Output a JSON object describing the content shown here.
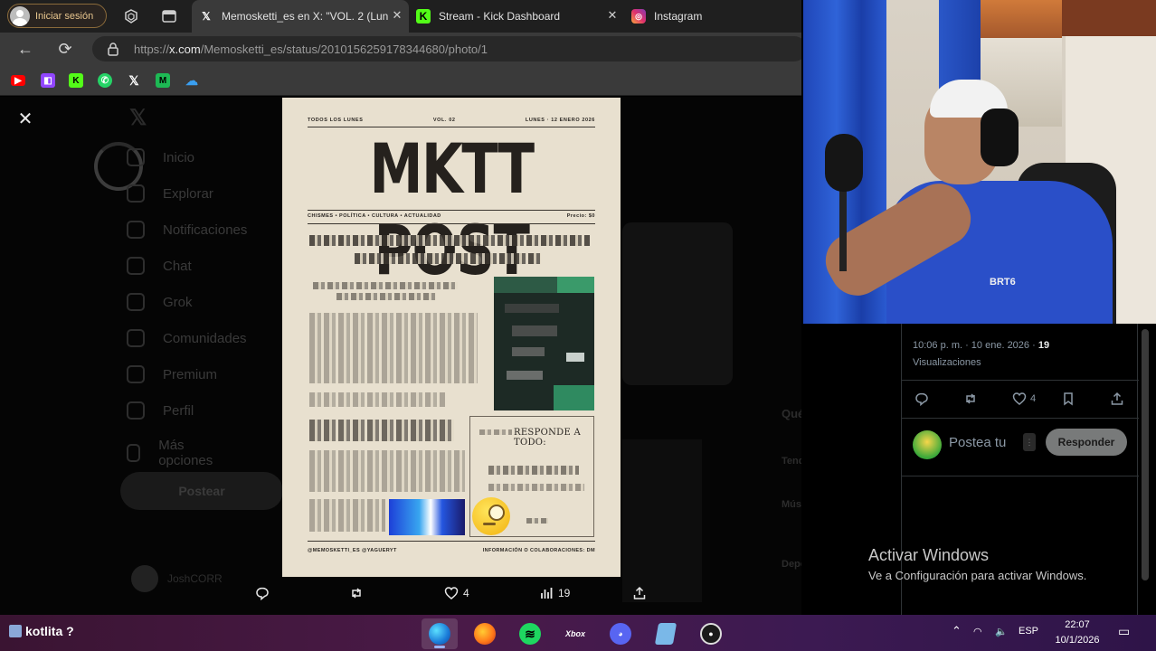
{
  "browser": {
    "profile_label": "Iniciar sesión",
    "tabs": [
      {
        "title": "Memosketti_es en X: \"VOL. 2 (Lun",
        "favicon": "X"
      },
      {
        "title": "Stream - Kick Dashboard",
        "favicon": "K"
      },
      {
        "title": "Instagram",
        "favicon": "instagram-icon"
      }
    ],
    "url_prefix": "https://",
    "url_host": "x.com",
    "url_path": "/Memosketti_es/status/2010156259178344680/photo/1",
    "bookmarks": [
      "youtube-icon",
      "twitch-icon",
      "kick-icon",
      "whatsapp-icon",
      "x-icon",
      "medium-icon",
      "cloud-icon"
    ]
  },
  "x_page": {
    "nav_items": [
      "Inicio",
      "Explorar",
      "Notificaciones",
      "Chat",
      "Grok",
      "Comunidades",
      "Premium",
      "Perfil",
      "Más opciones"
    ],
    "post_button": "Postear",
    "user_name": "JoshCORR",
    "side_heading": "Qué está pasando",
    "side_labels": [
      "Tendencias",
      "Música",
      "Deportes"
    ]
  },
  "newspaper": {
    "top_left": "TODOS LOS LUNES",
    "top_center": "VOL. 02",
    "top_right": "LUNES · 12 ENERO 2026",
    "masthead": "MKTT POST",
    "sections": "CHISMES • POLÍTICA • CULTURA • ACTUALIDAD",
    "price": "Precio: $0",
    "box_title": "RESPONDE A TODO:",
    "footer_left": "@MEMOSKETTI_ES   @YAGUERYT",
    "footer_right": "INFORMACIÓN O COLABORACIONES: DM"
  },
  "media_actions": {
    "likes": "4",
    "views": "19"
  },
  "tweet": {
    "timestamp": "10:06 p. m. · 10 ene. 2026 ·",
    "views_count": "19",
    "views_label": "Visualizaciones",
    "likes": "4",
    "reply_placeholder": "Postea tu",
    "reply_button": "Responder"
  },
  "overlay": {
    "activate_title": "Activar Windows",
    "activate_sub": "Ve a Configuración para activar Windows."
  },
  "webcam": {
    "shirt_text": "BRT6"
  },
  "taskbar": {
    "left_label": "kotlita ?",
    "apps": [
      "edge-icon",
      "firefox-icon",
      "spotify-icon",
      "xbox-icon",
      "discord-icon",
      "notepad-icon",
      "obs-icon"
    ],
    "language": "ESP",
    "time": "22:07",
    "date": "10/1/2026"
  }
}
